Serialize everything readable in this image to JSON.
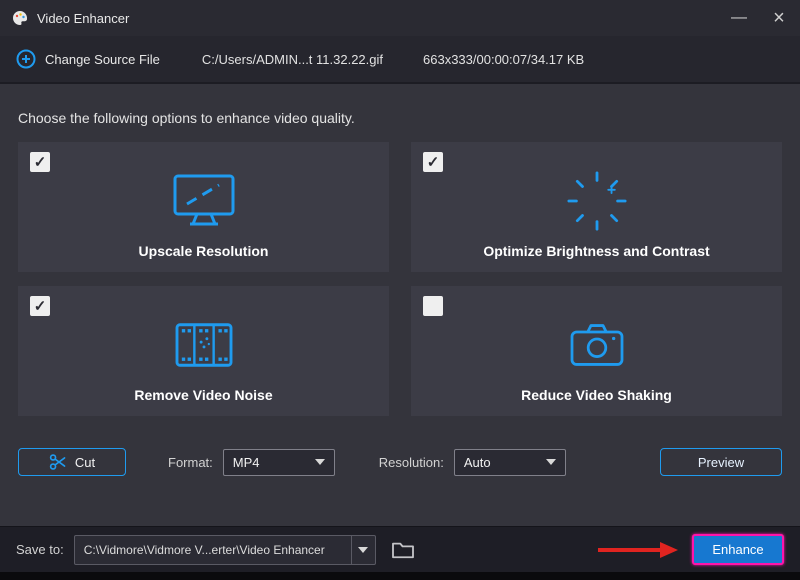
{
  "window": {
    "title": "Video Enhancer"
  },
  "source": {
    "change_label": "Change Source File",
    "file_path": "C:/Users/ADMIN...t 11.32.22.gif",
    "file_info": "663x333/00:00:07/34.17 KB"
  },
  "main": {
    "instruction": "Choose the following options to enhance video quality.",
    "options": [
      {
        "label": "Upscale Resolution",
        "checked": true,
        "icon": "monitor-upscale-icon"
      },
      {
        "label": "Optimize Brightness and Contrast",
        "checked": true,
        "icon": "brightness-contrast-icon"
      },
      {
        "label": "Remove Video Noise",
        "checked": true,
        "icon": "film-noise-icon"
      },
      {
        "label": "Reduce Video Shaking",
        "checked": false,
        "icon": "camera-shake-icon"
      }
    ]
  },
  "toolbar": {
    "cut": "Cut",
    "format_label": "Format:",
    "format_value": "MP4",
    "resolution_label": "Resolution:",
    "resolution_value": "Auto",
    "preview": "Preview"
  },
  "footer": {
    "save_to": "Save to:",
    "path": "C:\\Vidmore\\Vidmore V...erter\\Video Enhancer",
    "enhance": "Enhance"
  },
  "colors": {
    "accent_blue": "#1f9bef",
    "enhance_fill": "#1778d0",
    "annotation_magenta": "#ff14aa",
    "annotation_arrow_red": "#e02420"
  }
}
